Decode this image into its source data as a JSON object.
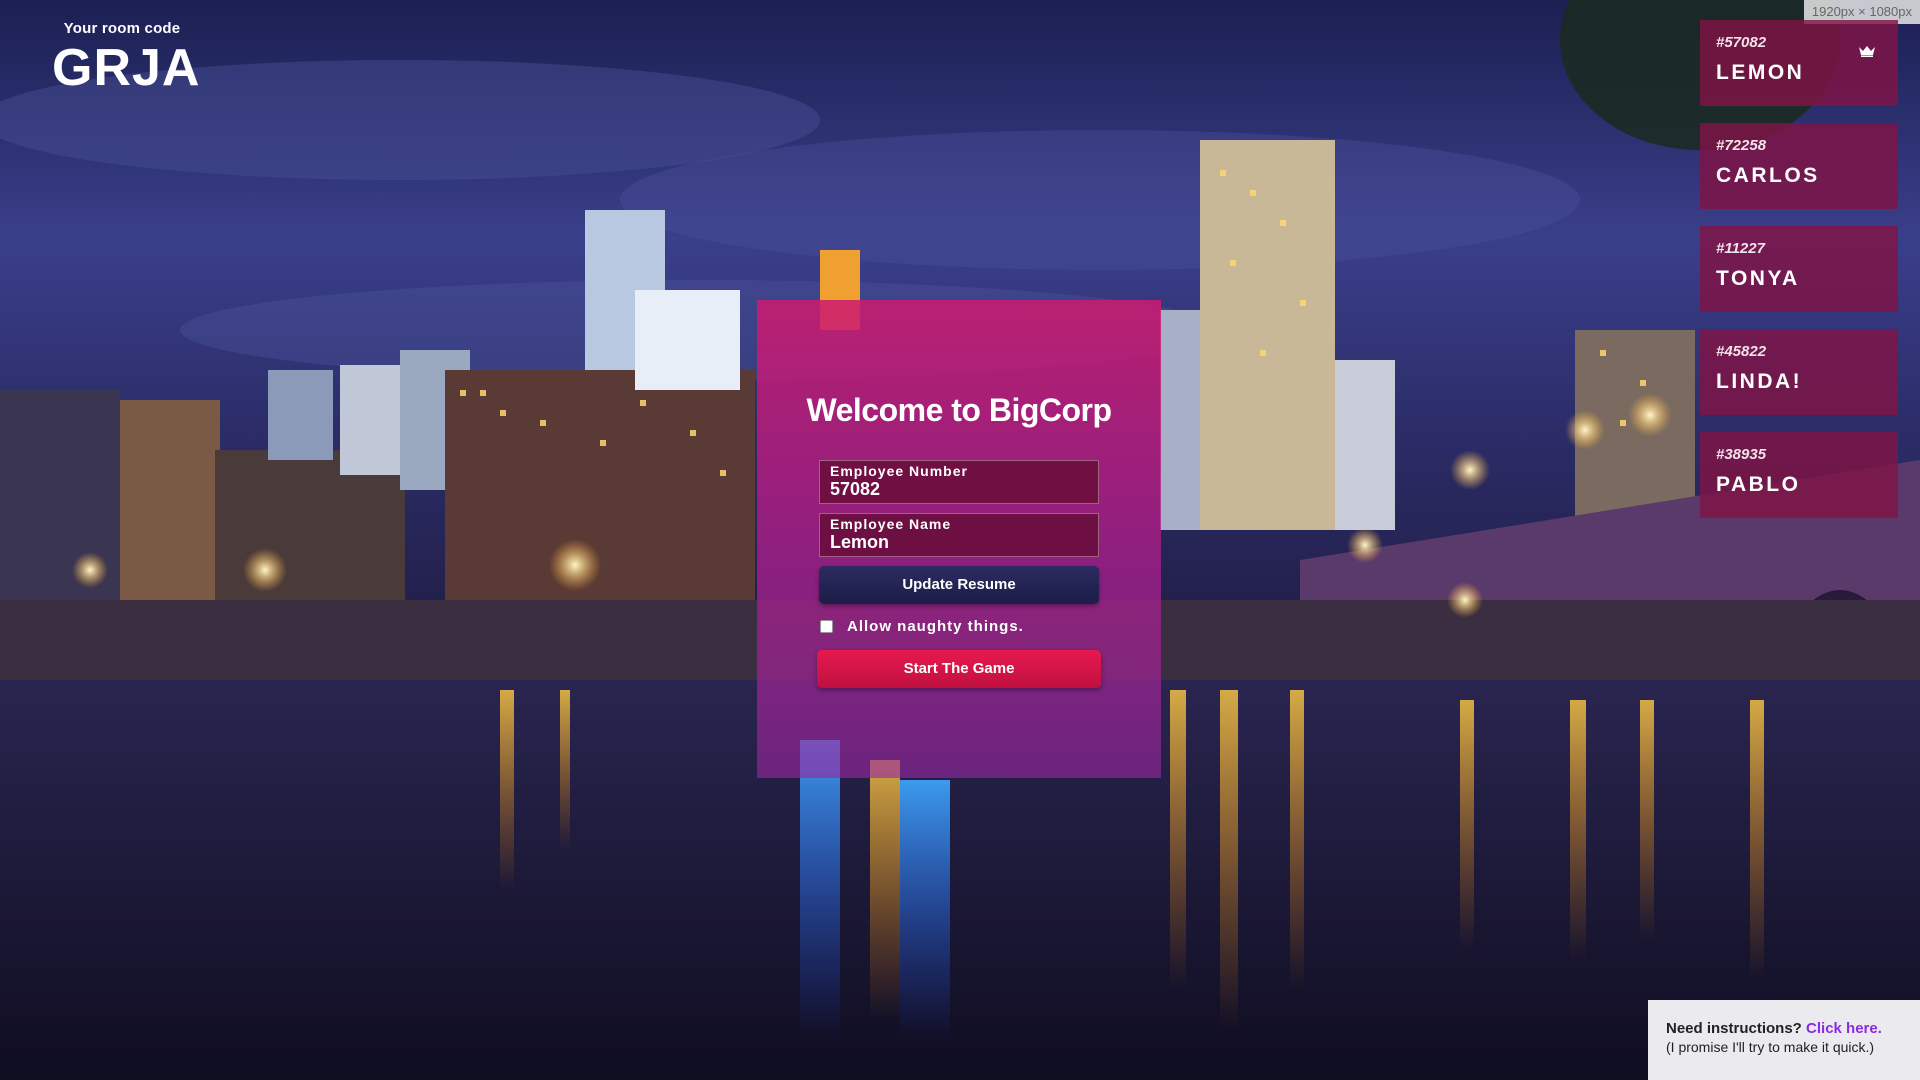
{
  "room": {
    "label": "Your room code",
    "code": "GRJA"
  },
  "resolution_badge": "1920px × 1080px",
  "players": [
    {
      "number": "#57082",
      "name": "LEMON",
      "host": true
    },
    {
      "number": "#72258",
      "name": "CARLOS",
      "host": false
    },
    {
      "number": "#11227",
      "name": "TONYA",
      "host": false
    },
    {
      "number": "#45822",
      "name": "LINDA!",
      "host": false
    },
    {
      "number": "#38935",
      "name": "PABLO",
      "host": false
    }
  ],
  "card": {
    "title": "Welcome to BigCorp",
    "employee_number": {
      "label": "Employee Number",
      "value": "57082"
    },
    "employee_name": {
      "label": "Employee Name",
      "value": "Lemon"
    },
    "update_button": "Update Resume",
    "naughty_label": "Allow naughty things.",
    "naughty_checked": false,
    "start_button": "Start The Game"
  },
  "help": {
    "question": "Need instructions?",
    "link": "Click here.",
    "sub": "(I promise I'll try to make it quick.)"
  },
  "colors": {
    "card_top": "#ce1a6e",
    "player_bg": "#801446",
    "update_button": "#1d1d48",
    "start_button": "#e8194f",
    "link": "#8a2be2"
  }
}
